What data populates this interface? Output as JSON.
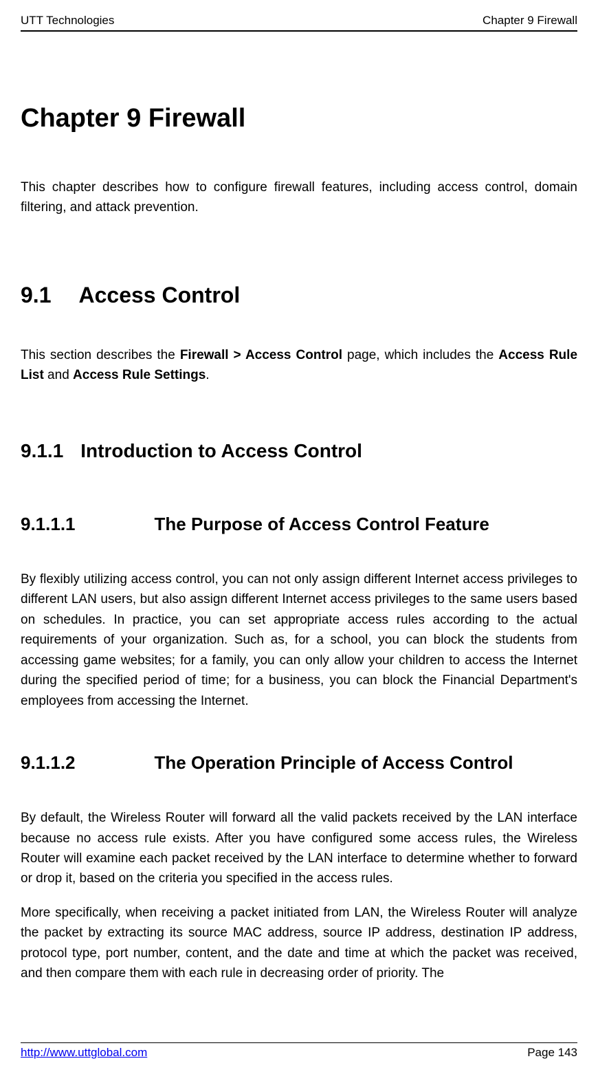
{
  "header": {
    "left": "UTT Technologies",
    "right": "Chapter 9 Firewall"
  },
  "chapter": {
    "title": "Chapter 9  Firewall",
    "intro": "This chapter describes how to configure firewall features, including access control, domain filtering, and attack prevention."
  },
  "section_9_1": {
    "number": "9.1",
    "title": "Access Control",
    "intro_pre": "This section describes the ",
    "intro_bold1": "Firewall > Access Control",
    "intro_mid1": " page, which includes the ",
    "intro_bold2": "Access Rule List",
    "intro_mid2": " and ",
    "intro_bold3": "Access Rule Settings",
    "intro_end": "."
  },
  "section_9_1_1": {
    "number": "9.1.1",
    "title": "Introduction to Access Control"
  },
  "section_9_1_1_1": {
    "number": "9.1.1.1",
    "title": "The Purpose of Access Control Feature",
    "body": "By flexibly utilizing access control, you can not only assign different Internet access privileges to different LAN users, but also assign different Internet access privileges to the same users based on schedules. In practice, you can set appropriate access rules according to the actual requirements of your organization. Such as, for a school, you can block the students from accessing game websites; for a family, you can only allow your children to access the Internet during the specified period of time; for a business, you can block the Financial Department's employees from accessing the Internet."
  },
  "section_9_1_1_2": {
    "number": "9.1.1.2",
    "title": "The Operation Principle of Access Control",
    "body1": "By default, the Wireless Router will forward all the valid packets received by the LAN interface because no access rule exists. After you have configured some access rules, the Wireless Router will examine each packet received by the LAN interface to determine whether to forward or drop it, based on the criteria you specified in the access rules.",
    "body2": "More specifically, when receiving a packet initiated from LAN, the Wireless Router will analyze the packet by extracting its source MAC address, source IP address, destination IP address, protocol type, port number, content, and the date and time at which the packet was received, and then compare them with each rule in decreasing order of priority. The"
  },
  "footer": {
    "link": "http://www.uttglobal.com",
    "page": "Page 143"
  }
}
